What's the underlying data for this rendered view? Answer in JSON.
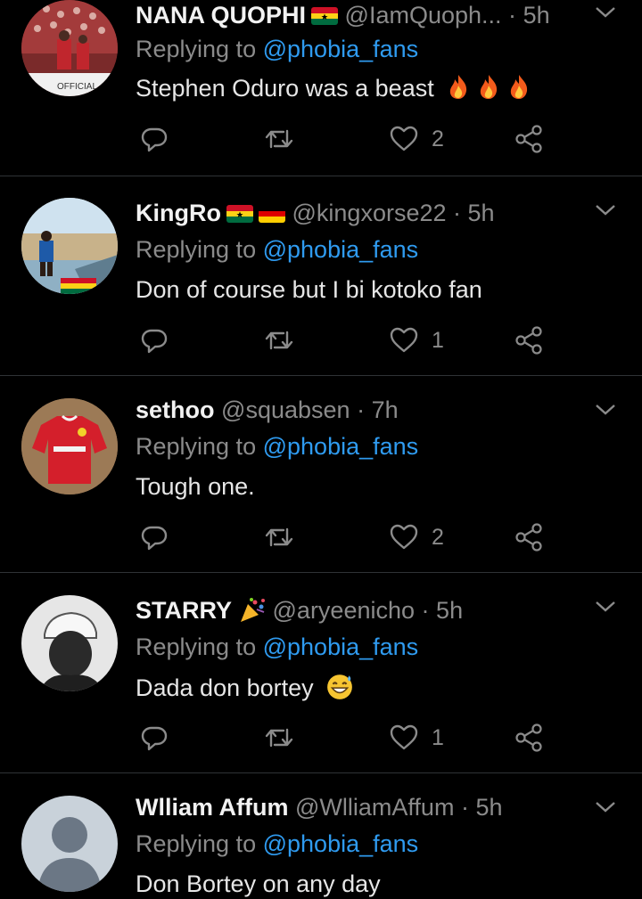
{
  "tweets": [
    {
      "name": "NANA QUOPHI",
      "flags": [
        "ghana"
      ],
      "handle": "@IamQuoph...",
      "dot": "·",
      "time": "5h",
      "reply_prefix": "Replying to",
      "reply_to": "@phobia_fans",
      "text": "Stephen Oduro was a beast",
      "emoji": [
        "fire",
        "fire",
        "fire"
      ],
      "likes": "2",
      "avatar": "stadium-crowd"
    },
    {
      "name": "KingRo",
      "flags": [
        "ghana",
        "germany"
      ],
      "handle": "@kingxorse22",
      "dot": "·",
      "time": "5h",
      "reply_prefix": "Replying to",
      "reply_to": "@phobia_fans",
      "text": "Don of course but I bi kotoko fan",
      "emoji": [],
      "likes": "1",
      "avatar": "beach-person"
    },
    {
      "name": "sethoo",
      "flags": [],
      "handle": "@squabsen",
      "dot": "·",
      "time": "7h",
      "reply_prefix": "Replying to",
      "reply_to": "@phobia_fans",
      "text": "Tough one.",
      "emoji": [],
      "likes": "2",
      "avatar": "red-jersey"
    },
    {
      "name": "STARRY",
      "flags": [
        "party-popper"
      ],
      "handle": "@aryeenicho",
      "dot": "·",
      "time": "5h",
      "reply_prefix": "Replying to",
      "reply_to": "@phobia_fans",
      "text": "Dada don bortey",
      "emoji": [
        "grinning-sweat"
      ],
      "likes": "1",
      "avatar": "person-cap"
    },
    {
      "name": "Wlliam Affum",
      "flags": [],
      "handle": "@WlliamAffum",
      "dot": "·",
      "time": "5h",
      "reply_prefix": "Replying to",
      "reply_to": "@phobia_fans",
      "text": "Don Bortey on any day",
      "emoji": [],
      "likes": "",
      "avatar": "default-avatar"
    }
  ],
  "icons": {
    "reply": "reply-icon",
    "retweet": "retweet-icon",
    "like": "like-icon",
    "share": "share-icon",
    "more": "chevron-down-icon"
  },
  "colors": {
    "background": "#000000",
    "mention": "#2f9bf0",
    "secondary": "#8b8b8b",
    "separator": "#2f3336"
  }
}
